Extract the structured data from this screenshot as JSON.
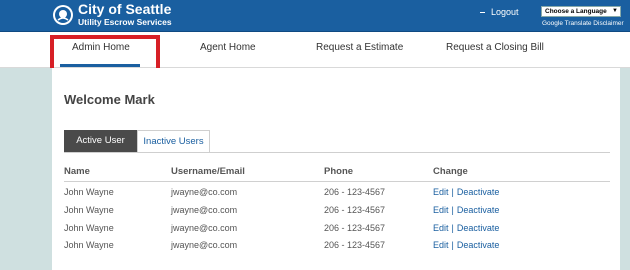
{
  "header": {
    "brand_title": "City of Seattle",
    "brand_subtitle": "Utility Escrow Services",
    "logout_label": "Logout",
    "language_select_value": "Choose a Language",
    "translate_disclaimer": "Google Translate Disclaimer"
  },
  "nav": {
    "items": [
      {
        "label": "Admin Home",
        "active": true
      },
      {
        "label": "Agent Home"
      },
      {
        "label": "Request a Estimate"
      },
      {
        "label": "Request a Closing Bill"
      }
    ]
  },
  "main": {
    "welcome": "Welcome Mark",
    "tabs": [
      {
        "label": "Active User",
        "active": true
      },
      {
        "label": "Inactive Users"
      }
    ],
    "table": {
      "headers": [
        "Name",
        "Username/Email",
        "Phone",
        "Change"
      ],
      "rows": [
        {
          "name": "John Wayne",
          "email": "jwayne@co.com",
          "phone": "206 - 123-4567",
          "edit": "Edit",
          "sep": "|",
          "deactivate": "Deactivate"
        },
        {
          "name": "John Wayne",
          "email": "jwayne@co.com",
          "phone": "206 - 123-4567",
          "edit": "Edit",
          "sep": "|",
          "deactivate": "Deactivate"
        },
        {
          "name": "John Wayne",
          "email": "jwayne@co.com",
          "phone": "206 - 123-4567",
          "edit": "Edit",
          "sep": "|",
          "deactivate": "Deactivate"
        },
        {
          "name": "John Wayne",
          "email": "jwayne@co.com",
          "phone": "206 - 123-4567",
          "edit": "Edit",
          "sep": "|",
          "deactivate": "Deactivate"
        }
      ]
    }
  },
  "colors": {
    "brand_blue": "#1a5fa0",
    "highlight_red": "#d71f26",
    "side_background": "#cfe0e0"
  },
  "icons": {
    "logo": "city-seal-icon",
    "logout": "logout-dash-icon",
    "language_caret": "chevron-down-icon"
  }
}
